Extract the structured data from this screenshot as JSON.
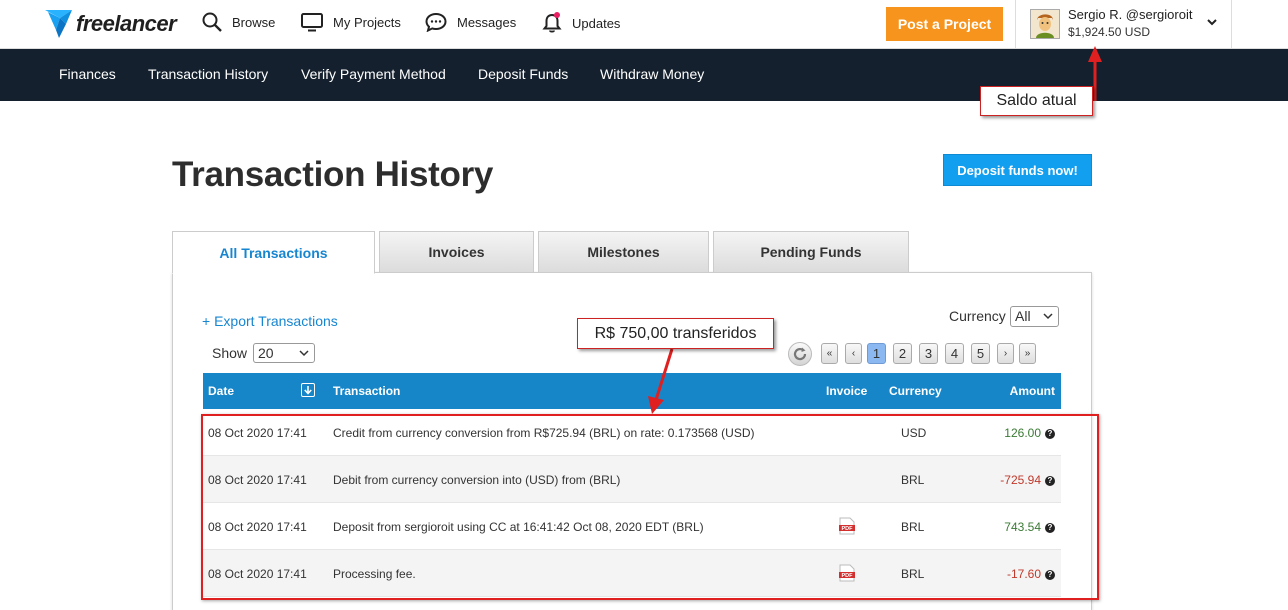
{
  "header": {
    "logo_text": "freelancer",
    "nav": [
      {
        "label": "Browse",
        "icon": "search-icon"
      },
      {
        "label": "My Projects",
        "icon": "monitor-icon"
      },
      {
        "label": "Messages",
        "icon": "chat-icon"
      },
      {
        "label": "Updates",
        "icon": "bell-icon"
      }
    ],
    "post_button": "Post a Project",
    "user": {
      "name": "Sergio R. @sergioroit",
      "balance": "$1,924.50 USD"
    }
  },
  "subnav": [
    "Finances",
    "Transaction History",
    "Verify Payment Method",
    "Deposit Funds",
    "Withdraw Money"
  ],
  "page": {
    "title": "Transaction History",
    "deposit_button": "Deposit funds now!"
  },
  "tabs": [
    "All Transactions",
    "Invoices",
    "Milestones",
    "Pending Funds"
  ],
  "controls": {
    "export_link": "+ Export Transactions",
    "show_label": "Show",
    "show_value": "20",
    "currency_label": "Currency",
    "currency_value": "All",
    "pagination": {
      "first": "«",
      "prev": "‹",
      "pages": [
        "1",
        "2",
        "3",
        "4",
        "5"
      ],
      "current": "1",
      "next": "›",
      "last": "»"
    }
  },
  "table": {
    "columns": [
      "Date",
      "Transaction",
      "Invoice",
      "Currency",
      "Amount"
    ],
    "rows": [
      {
        "date": "08 Oct 2020 17:41",
        "transaction": "Credit from currency conversion from R$725.94 (BRL) on rate: 0.173568 (USD)",
        "invoice": "",
        "currency": "USD",
        "amount": "126.00"
      },
      {
        "date": "08 Oct 2020 17:41",
        "transaction": "Debit from currency conversion into (USD) from (BRL)",
        "invoice": "",
        "currency": "BRL",
        "amount": "-725.94"
      },
      {
        "date": "08 Oct 2020 17:41",
        "transaction": "Deposit from sergioroit using CC at 16:41:42 Oct 08, 2020 EDT (BRL)",
        "invoice": "PDF",
        "currency": "BRL",
        "amount": "743.54"
      },
      {
        "date": "08 Oct 2020 17:41",
        "transaction": "Processing fee.",
        "invoice": "PDF",
        "currency": "BRL",
        "amount": "-17.60"
      }
    ]
  },
  "annotations": {
    "balance_callout": "Saldo atual",
    "transfer_callout": "R$ 750,00 transferidos"
  },
  "colors": {
    "brand_blue": "#1786c8",
    "post_orange": "#f7941d",
    "subnav_bg": "#14202e",
    "annotation_red": "#e02020"
  }
}
